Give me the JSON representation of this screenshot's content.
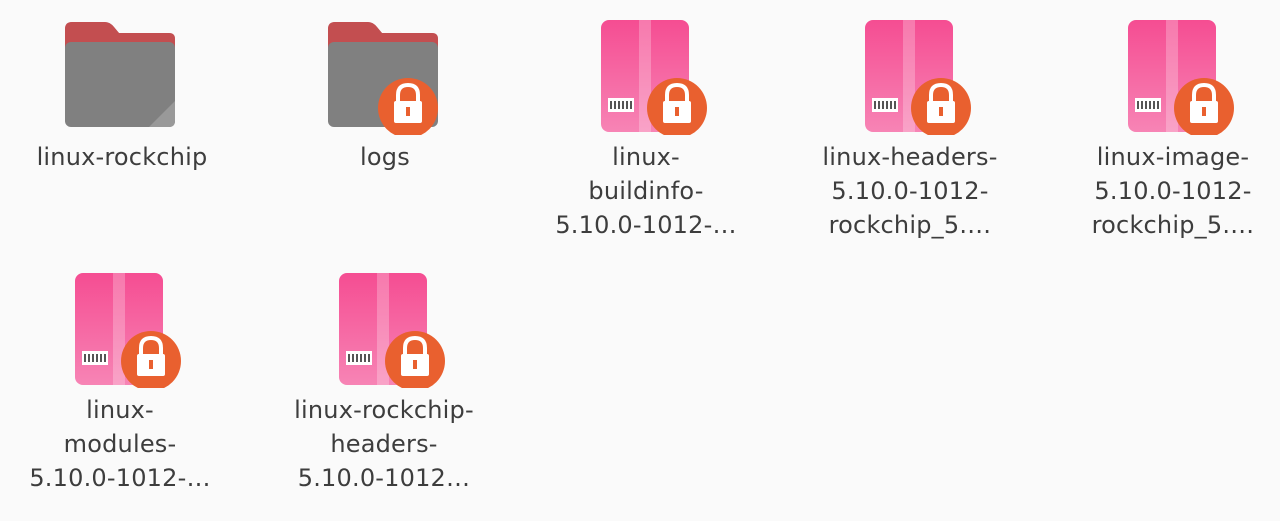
{
  "colors": {
    "folder_body": "#808080",
    "folder_tab": "#b3416a",
    "package_pink": "#f77fb0",
    "package_pink_dark": "#ee4d8e",
    "lock_badge": "#e9602f",
    "label_text": "#3d3d3d",
    "background": "#fafafa"
  },
  "items": [
    {
      "type": "folder",
      "locked": false,
      "label": "linux-rockchip",
      "icon": "folder-icon"
    },
    {
      "type": "folder",
      "locked": true,
      "label": "logs",
      "icon": "folder-icon"
    },
    {
      "type": "package",
      "locked": true,
      "label": "linux-\nbuildinfo-\n5.10.0-1012-…",
      "icon": "package-icon"
    },
    {
      "type": "package",
      "locked": true,
      "label": "linux-headers-\n5.10.0-1012-\nrockchip_5.…",
      "icon": "package-icon"
    },
    {
      "type": "package",
      "locked": true,
      "label": "linux-image-\n5.10.0-1012-\nrockchip_5.…",
      "icon": "package-icon"
    },
    {
      "type": "package",
      "locked": true,
      "label": "linux-\nmodules-\n5.10.0-1012-…",
      "icon": "package-icon"
    },
    {
      "type": "package",
      "locked": true,
      "label": "linux-rockchip-\nheaders-\n5.10.0-1012…",
      "icon": "package-icon"
    }
  ]
}
